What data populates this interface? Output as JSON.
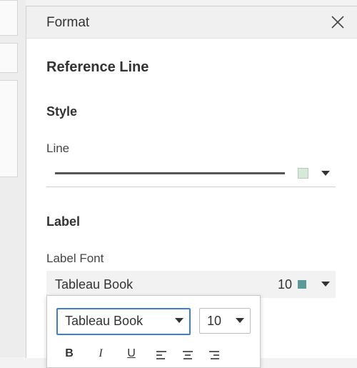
{
  "panel": {
    "title": "Format",
    "close_icon": "close-icon",
    "heading": "Reference Line"
  },
  "style_section": {
    "title": "Style",
    "line_label": "Line",
    "line_color": "#d6ead9",
    "line_sample_color": "#555555"
  },
  "label_section": {
    "title": "Label",
    "label_font_label": "Label Font",
    "font_name": "Tableau Book",
    "font_size": "10",
    "font_color": "#5a9b98"
  },
  "font_popup": {
    "font_family_value": "Tableau Book",
    "font_size_value": "10",
    "buttons": {
      "bold": "B",
      "italic": "I",
      "underline": "U"
    },
    "icons": [
      "align-left-icon",
      "align-center-icon",
      "align-right-icon"
    ],
    "accent_color": "#3f7fcf"
  }
}
